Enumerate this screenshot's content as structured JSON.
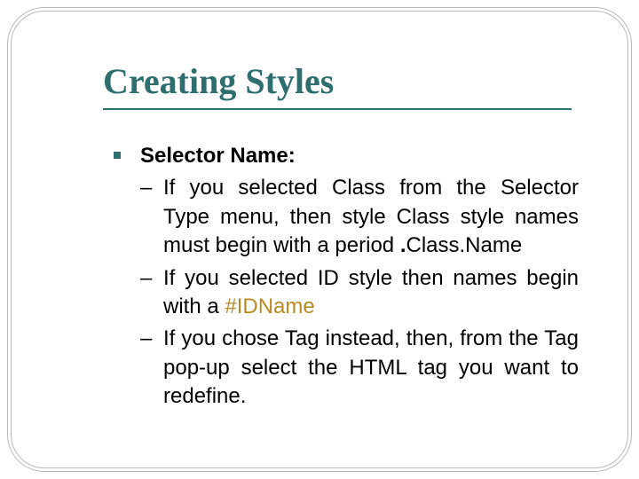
{
  "title": "Creating Styles",
  "item": {
    "heading": "Selector Name:"
  },
  "sub": {
    "a": {
      "pre": "If you selected Class from the Selector Type menu, then style Class style names must begin with a period ",
      "dot": ".",
      "post": "Class.Name"
    },
    "b": {
      "pre": "If you selected ID style then names begin with a ",
      "idname": "#IDName"
    },
    "c": {
      "text": "If you chose Tag instead, then, from the Tag pop-up select the HTML tag you want to redefine."
    }
  }
}
